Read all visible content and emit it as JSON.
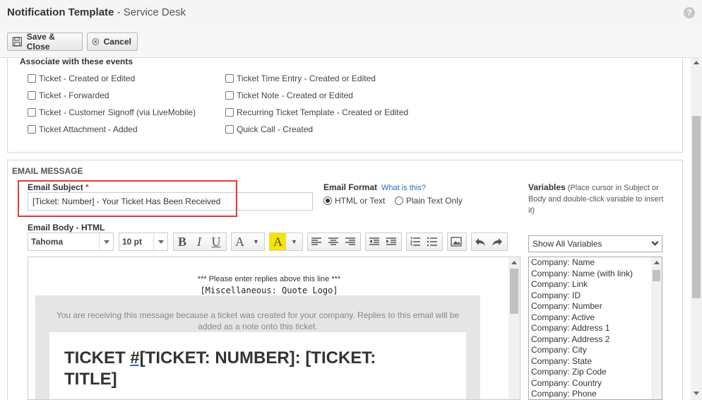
{
  "window": {
    "title": "Notification Template",
    "subtitle": "- Service Desk"
  },
  "toolbar": {
    "save_label": "Save & Close",
    "cancel_label": "Cancel"
  },
  "events": {
    "heading": "Associate with these events",
    "left": [
      "Ticket - Created or Edited",
      "Ticket - Forwarded",
      "Ticket - Customer Signoff (via LiveMobile)",
      "Ticket Attachment - Added"
    ],
    "right": [
      "Ticket Time Entry - Created or Edited",
      "Ticket Note - Created or Edited",
      "Recurring Ticket Template - Created or Edited",
      "Quick Call - Created"
    ]
  },
  "email": {
    "heading": "EMAIL MESSAGE",
    "subject_label": "Email Subject",
    "required_mark": "*",
    "subject_value": "[Ticket: Number] - Your Ticket Has Been Received",
    "format_label": "Email Format",
    "format_help": "What is this?",
    "format_html": "HTML or Text",
    "format_plain": "Plain Text Only",
    "body_label": "Email Body - HTML",
    "font_name": "Tahoma",
    "font_size": "10 pt"
  },
  "variables": {
    "label": "Variables",
    "hint": "(Place cursor in Subject or Body and double-click variable to insert it)",
    "filter_value": "Show All Variables",
    "items": [
      "Company: Name",
      "Company: Name (with link)",
      "Company: Link",
      "Company: ID",
      "Company: Number",
      "Company: Active",
      "Company: Address 1",
      "Company: Address 2",
      "Company: City",
      "Company: State",
      "Company: Zip Code",
      "Company: Country",
      "Company: Phone"
    ]
  },
  "body": {
    "reply_line": "*** Please enter replies above this line ***",
    "logo_placeholder": "[Miscellaneous: Quote Logo]",
    "note": "You are receiving this message because a ticket was created for your company. Replies to this email will be added as a note onto this ticket.",
    "title_prefix": "TICKET ",
    "title_hash": "#[",
    "title_rest": "TICKET: NUMBER]: [TICKET: TITLE]"
  }
}
